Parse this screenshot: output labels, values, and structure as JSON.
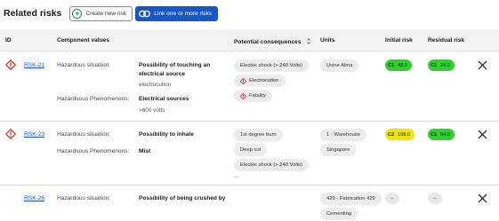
{
  "header": {
    "title": "Related risks",
    "create_label": "Create new risk",
    "link_label": "Link one or more risks"
  },
  "columns": {
    "id": "ID",
    "component": "Component values",
    "consequences": "Potential consequences",
    "units": "Units",
    "initial": "Initial risk",
    "residual": "Residual risk"
  },
  "rows": [
    {
      "id": "RSK-21",
      "situation_label": "Hazardous situation:",
      "situation_value": "Possibility of touching an electrical source",
      "situation_sub": "electrocution",
      "phenomena_label": "Hazardsous Phenomenons:",
      "phenomena_value": "Electrical sources",
      "phenomena_sub": ">600 volts",
      "consequences": [
        "Electric shock (> 240 Volts)",
        "Electrocution",
        "Fatality"
      ],
      "units": [
        "Usine Alma"
      ],
      "initial": {
        "code": "C1",
        "value": "48.0",
        "color": "#2fd12f"
      },
      "residual": {
        "code": "C1",
        "value": "24.0",
        "color": "#2fd12f"
      }
    },
    {
      "id": "RSK-23",
      "situation_label": "Hazardous situation:",
      "situation_value": "Possibility to inhale",
      "phenomena_label": "Hazardsous Phenomenons:",
      "phenomena_value": "Mist",
      "consequences": [
        "1st degree burn",
        "Deep cut",
        "Electric shock (> 240 Volts)"
      ],
      "consequences_more": "...",
      "units": [
        "1 - Warehouse",
        "Singapore"
      ],
      "initial": {
        "code": "C2",
        "value": "108.0",
        "color": "#f2e600"
      },
      "residual": {
        "code": "C1",
        "value": "54.0",
        "color": "#2fd12f"
      }
    },
    {
      "id": "RSK-26",
      "situation_label": "Hazardous situation:",
      "situation_value": "Possibility of being crushed by",
      "units": [
        "429 - Fabrication 429",
        "Cementing"
      ],
      "initial": {
        "code": "--"
      },
      "residual": {
        "code": "--"
      }
    }
  ],
  "icons": {
    "create": "plus-circle-icon",
    "link": "link-icon",
    "danger": "warning-diamond-icon",
    "remove": "close-icon"
  },
  "colors": {
    "primary": "#1557c4",
    "low_risk": "#2fd12f",
    "medium_risk": "#f2e600",
    "danger": "#d21f1f"
  }
}
